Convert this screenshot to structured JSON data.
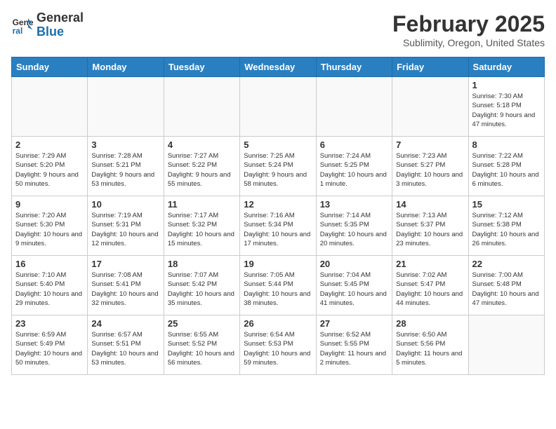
{
  "header": {
    "logo_general": "General",
    "logo_blue": "Blue",
    "month_title": "February 2025",
    "subtitle": "Sublimity, Oregon, United States"
  },
  "days_of_week": [
    "Sunday",
    "Monday",
    "Tuesday",
    "Wednesday",
    "Thursday",
    "Friday",
    "Saturday"
  ],
  "weeks": [
    [
      {
        "day": "",
        "info": ""
      },
      {
        "day": "",
        "info": ""
      },
      {
        "day": "",
        "info": ""
      },
      {
        "day": "",
        "info": ""
      },
      {
        "day": "",
        "info": ""
      },
      {
        "day": "",
        "info": ""
      },
      {
        "day": "1",
        "info": "Sunrise: 7:30 AM\nSunset: 5:18 PM\nDaylight: 9 hours and 47 minutes."
      }
    ],
    [
      {
        "day": "2",
        "info": "Sunrise: 7:29 AM\nSunset: 5:20 PM\nDaylight: 9 hours and 50 minutes."
      },
      {
        "day": "3",
        "info": "Sunrise: 7:28 AM\nSunset: 5:21 PM\nDaylight: 9 hours and 53 minutes."
      },
      {
        "day": "4",
        "info": "Sunrise: 7:27 AM\nSunset: 5:22 PM\nDaylight: 9 hours and 55 minutes."
      },
      {
        "day": "5",
        "info": "Sunrise: 7:25 AM\nSunset: 5:24 PM\nDaylight: 9 hours and 58 minutes."
      },
      {
        "day": "6",
        "info": "Sunrise: 7:24 AM\nSunset: 5:25 PM\nDaylight: 10 hours and 1 minute."
      },
      {
        "day": "7",
        "info": "Sunrise: 7:23 AM\nSunset: 5:27 PM\nDaylight: 10 hours and 3 minutes."
      },
      {
        "day": "8",
        "info": "Sunrise: 7:22 AM\nSunset: 5:28 PM\nDaylight: 10 hours and 6 minutes."
      }
    ],
    [
      {
        "day": "9",
        "info": "Sunrise: 7:20 AM\nSunset: 5:30 PM\nDaylight: 10 hours and 9 minutes."
      },
      {
        "day": "10",
        "info": "Sunrise: 7:19 AM\nSunset: 5:31 PM\nDaylight: 10 hours and 12 minutes."
      },
      {
        "day": "11",
        "info": "Sunrise: 7:17 AM\nSunset: 5:32 PM\nDaylight: 10 hours and 15 minutes."
      },
      {
        "day": "12",
        "info": "Sunrise: 7:16 AM\nSunset: 5:34 PM\nDaylight: 10 hours and 17 minutes."
      },
      {
        "day": "13",
        "info": "Sunrise: 7:14 AM\nSunset: 5:35 PM\nDaylight: 10 hours and 20 minutes."
      },
      {
        "day": "14",
        "info": "Sunrise: 7:13 AM\nSunset: 5:37 PM\nDaylight: 10 hours and 23 minutes."
      },
      {
        "day": "15",
        "info": "Sunrise: 7:12 AM\nSunset: 5:38 PM\nDaylight: 10 hours and 26 minutes."
      }
    ],
    [
      {
        "day": "16",
        "info": "Sunrise: 7:10 AM\nSunset: 5:40 PM\nDaylight: 10 hours and 29 minutes."
      },
      {
        "day": "17",
        "info": "Sunrise: 7:08 AM\nSunset: 5:41 PM\nDaylight: 10 hours and 32 minutes."
      },
      {
        "day": "18",
        "info": "Sunrise: 7:07 AM\nSunset: 5:42 PM\nDaylight: 10 hours and 35 minutes."
      },
      {
        "day": "19",
        "info": "Sunrise: 7:05 AM\nSunset: 5:44 PM\nDaylight: 10 hours and 38 minutes."
      },
      {
        "day": "20",
        "info": "Sunrise: 7:04 AM\nSunset: 5:45 PM\nDaylight: 10 hours and 41 minutes."
      },
      {
        "day": "21",
        "info": "Sunrise: 7:02 AM\nSunset: 5:47 PM\nDaylight: 10 hours and 44 minutes."
      },
      {
        "day": "22",
        "info": "Sunrise: 7:00 AM\nSunset: 5:48 PM\nDaylight: 10 hours and 47 minutes."
      }
    ],
    [
      {
        "day": "23",
        "info": "Sunrise: 6:59 AM\nSunset: 5:49 PM\nDaylight: 10 hours and 50 minutes."
      },
      {
        "day": "24",
        "info": "Sunrise: 6:57 AM\nSunset: 5:51 PM\nDaylight: 10 hours and 53 minutes."
      },
      {
        "day": "25",
        "info": "Sunrise: 6:55 AM\nSunset: 5:52 PM\nDaylight: 10 hours and 56 minutes."
      },
      {
        "day": "26",
        "info": "Sunrise: 6:54 AM\nSunset: 5:53 PM\nDaylight: 10 hours and 59 minutes."
      },
      {
        "day": "27",
        "info": "Sunrise: 6:52 AM\nSunset: 5:55 PM\nDaylight: 11 hours and 2 minutes."
      },
      {
        "day": "28",
        "info": "Sunrise: 6:50 AM\nSunset: 5:56 PM\nDaylight: 11 hours and 5 minutes."
      },
      {
        "day": "",
        "info": ""
      }
    ]
  ]
}
